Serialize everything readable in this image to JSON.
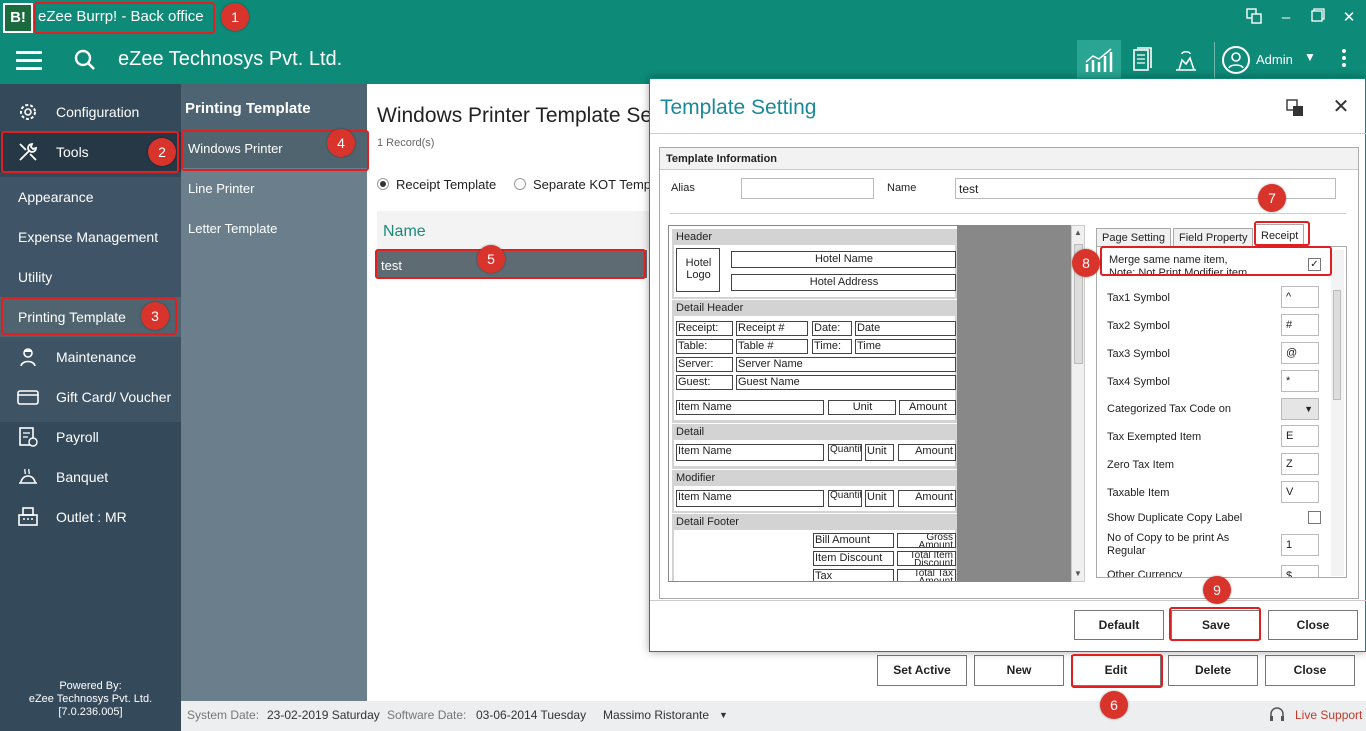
{
  "window": {
    "logo_text": "B!",
    "title": "eZee Burrp! - Back office"
  },
  "topbar": {
    "company": "eZee Technosys Pvt. Ltd.",
    "user": "Admin"
  },
  "leftnav": {
    "items": [
      {
        "label": "Configuration",
        "icon": "gears-icon"
      },
      {
        "label": "Tools",
        "icon": "tools-icon"
      },
      {
        "label": "Maintenance",
        "icon": "maintenance-icon"
      },
      {
        "label": "Gift Card/ Voucher",
        "icon": "gift-card-icon"
      },
      {
        "label": "Payroll",
        "icon": "payroll-icon"
      },
      {
        "label": "Banquet",
        "icon": "banquet-icon"
      },
      {
        "label": "Outlet : MR",
        "icon": "outlet-icon"
      }
    ],
    "subitems": [
      "Appearance",
      "Expense Management",
      "Utility",
      "Printing Template"
    ],
    "powered_by": "Powered By:",
    "powered_company": "eZee Technosys Pvt. Ltd.",
    "version": "[7.0.236.005]"
  },
  "panel2": {
    "title": "Printing Template",
    "items": [
      "Windows Printer",
      "Line Printer",
      "Letter Template"
    ]
  },
  "main": {
    "title": "Windows Printer Template Se",
    "record_count": "1 Record(s)",
    "radio_receipt": "Receipt Template",
    "radio_kot": "Separate KOT Templa",
    "grid_header": "Name",
    "grid_row": "test",
    "buttons": [
      "Set Active",
      "New",
      "Edit",
      "Delete",
      "Close"
    ]
  },
  "statusbar": {
    "system_date_label": "System Date:",
    "system_date": "23-02-2019 Saturday",
    "software_date_label": "Software Date:",
    "software_date": "03-06-2014 Tuesday",
    "outlet": "Massimo Ristorante",
    "live_support": "Live Support"
  },
  "dialog": {
    "title": "Template Setting",
    "section": "Template Information",
    "alias_label": "Alias",
    "alias_value": "",
    "name_label": "Name",
    "name_value": "test",
    "tabs": [
      "Page Setting",
      "Field Property",
      "Receipt"
    ],
    "buttons": [
      "Default",
      "Save",
      "Close"
    ]
  },
  "preview": {
    "header_title": "Header",
    "hotel_logo": "Hotel Logo",
    "hotel_name": "Hotel Name",
    "hotel_address": "Hotel Address",
    "detail_header_title": "Detail Header",
    "receipt_label": "Receipt:",
    "receipt_no": "Receipt #",
    "date_label": "Date:",
    "date_value": "Date",
    "table_label": "Table:",
    "table_no": "Table #",
    "time_label": "Time:",
    "time_value": "Time",
    "server_label": "Server:",
    "server_name": "Server Name",
    "guest_label": "Guest:",
    "guest_name": "Guest Name",
    "item_name": "Item Name",
    "unit": "Unit",
    "amount": "Amount",
    "detail_title": "Detail",
    "quantity": "Quantity",
    "modifier_title": "Modifier",
    "detail_footer_title": "Detail Footer",
    "bill_amount": "Bill Amount",
    "gross_amount": "Gross Amount",
    "item_discount": "Item Discount",
    "total_item_discount": "Total Item Discount",
    "tax": "Tax",
    "total_tax_amount": "Total Tax Amount"
  },
  "receipt_props": {
    "merge_line1": "Merge same name item,",
    "merge_line2": "Note: Not Print Modifier item",
    "merge_checked": "✓",
    "tax1_label": "Tax1 Symbol",
    "tax1": "^",
    "tax2_label": "Tax2 Symbol",
    "tax2": "#",
    "tax3_label": "Tax3 Symbol",
    "tax3": "@",
    "tax4_label": "Tax4 Symbol",
    "tax4": "*",
    "categorized_label": "Categorized Tax Code on",
    "tax_exempted_label": "Tax Exempted Item",
    "tax_exempted": "E",
    "zero_tax_label": "Zero Tax Item",
    "zero_tax": "Z",
    "taxable_label": "Taxable Item",
    "taxable": "V",
    "dup_copy_label": "Show Duplicate Copy Label",
    "copies_label": "No of Copy to be print As Regular",
    "copies": "1",
    "other_currency_label": "Other Currency",
    "other_currency": "$"
  },
  "annotations": [
    "1",
    "2",
    "3",
    "4",
    "5",
    "6",
    "7",
    "8",
    "9"
  ],
  "colors": {
    "teal": "#0e8a79",
    "nav": "#34495a",
    "highlight": "#e02020",
    "badge": "#d9342b"
  }
}
